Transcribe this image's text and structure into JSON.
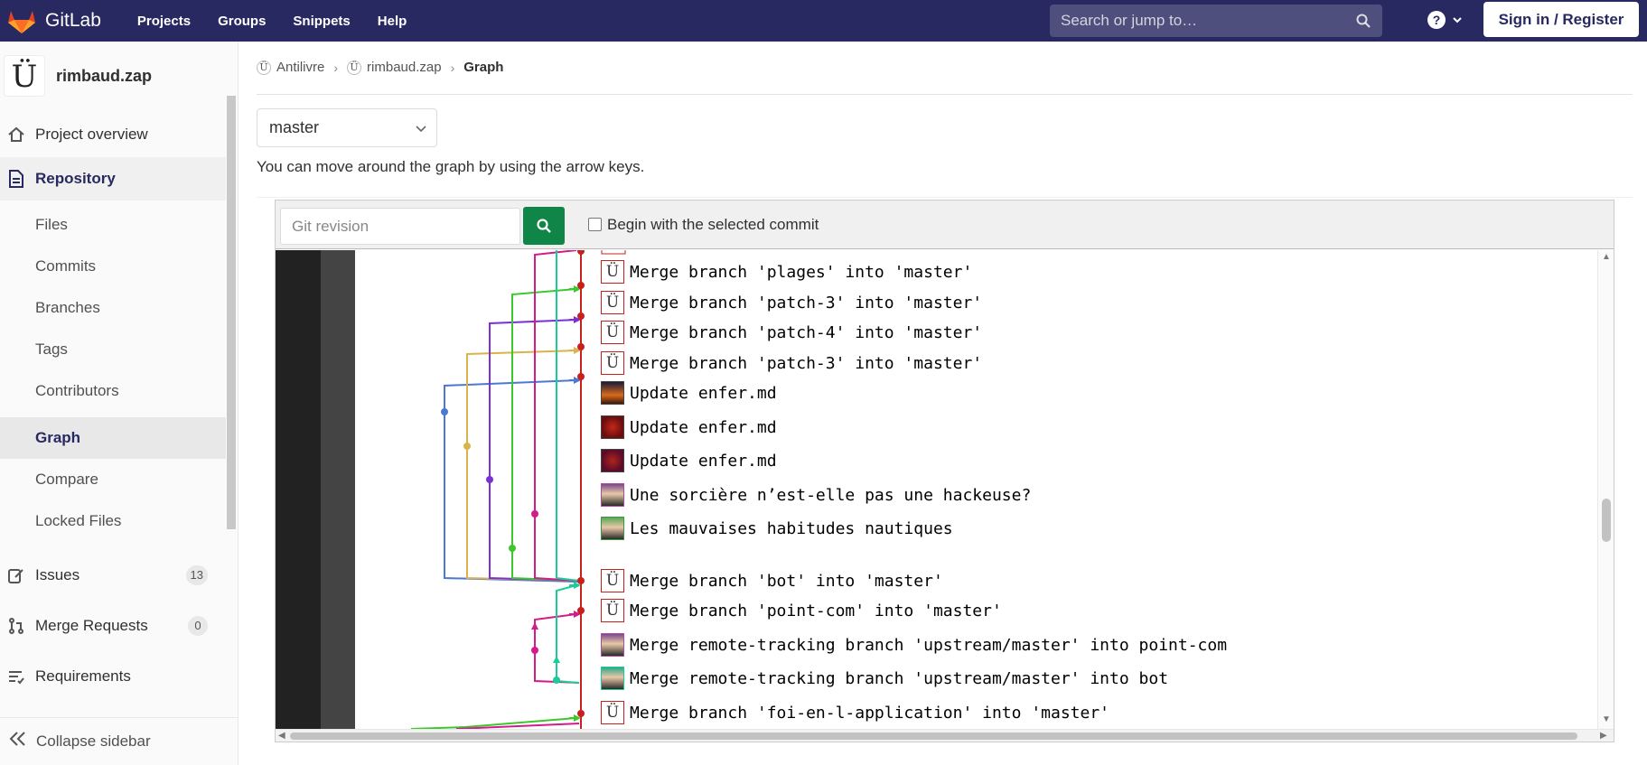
{
  "nav": {
    "brand": "GitLab",
    "links": [
      "Projects",
      "Groups",
      "Snippets",
      "Help"
    ],
    "search_placeholder": "Search or jump to…",
    "help_glyph": "?",
    "sign_in": "Sign in / Register"
  },
  "sidebar": {
    "project_avatar": "Ü",
    "project_name": "rimbaud.zap",
    "overview": "Project overview",
    "repository": "Repository",
    "repo_items": [
      "Files",
      "Commits",
      "Branches",
      "Tags",
      "Contributors",
      "Graph",
      "Compare",
      "Locked Files"
    ],
    "issues": {
      "label": "Issues",
      "count": "13"
    },
    "merge_requests": {
      "label": "Merge Requests",
      "count": "0"
    },
    "requirements": "Requirements",
    "collapse": "Collapse sidebar"
  },
  "breadcrumb": {
    "items": [
      {
        "icon": "Ü",
        "label": "Antilivre"
      },
      {
        "icon": "Ü",
        "label": "rimbaud.zap"
      }
    ],
    "current": "Graph"
  },
  "branch_select": {
    "value": "master"
  },
  "hint": "You can move around the graph by using the arrow keys.",
  "graph_toolbar": {
    "revision_placeholder": "Git revision",
    "checkbox_label": "Begin with the selected commit"
  },
  "commits": [
    {
      "avatar": "Ü",
      "message": "Merge branch 'plages' into 'master'"
    },
    {
      "avatar": "Ü",
      "message": "Merge branch 'patch-3' into 'master'"
    },
    {
      "avatar": "Ü",
      "message": "Merge branch 'patch-4' into 'master'"
    },
    {
      "avatar": "Ü",
      "message": "Merge branch 'patch-3' into 'master'"
    },
    {
      "avatar": "",
      "message": "Update enfer.md"
    },
    {
      "avatar": "",
      "message": "Update enfer.md"
    },
    {
      "avatar": "",
      "message": "Update enfer.md"
    },
    {
      "avatar": "",
      "message": "Une sorcière n’est-elle pas une hackeuse?"
    },
    {
      "avatar": "",
      "message": "Les mauvaises habitudes nautiques"
    },
    {
      "avatar": "Ü",
      "message": "Merge branch 'bot' into 'master'"
    },
    {
      "avatar": "Ü",
      "message": "Merge branch 'point-com' into 'master'"
    },
    {
      "avatar": "",
      "message": "Merge remote-tracking branch 'upstream/master' into point-com"
    },
    {
      "avatar": "",
      "message": "Merge remote-tracking branch 'upstream/master' into bot"
    },
    {
      "avatar": "Ü",
      "message": "Merge branch 'foi-en-l-application' into 'master'"
    }
  ],
  "colors": {
    "navbar": "#292961",
    "master_line": "#c8201d",
    "search_button": "#108548"
  }
}
